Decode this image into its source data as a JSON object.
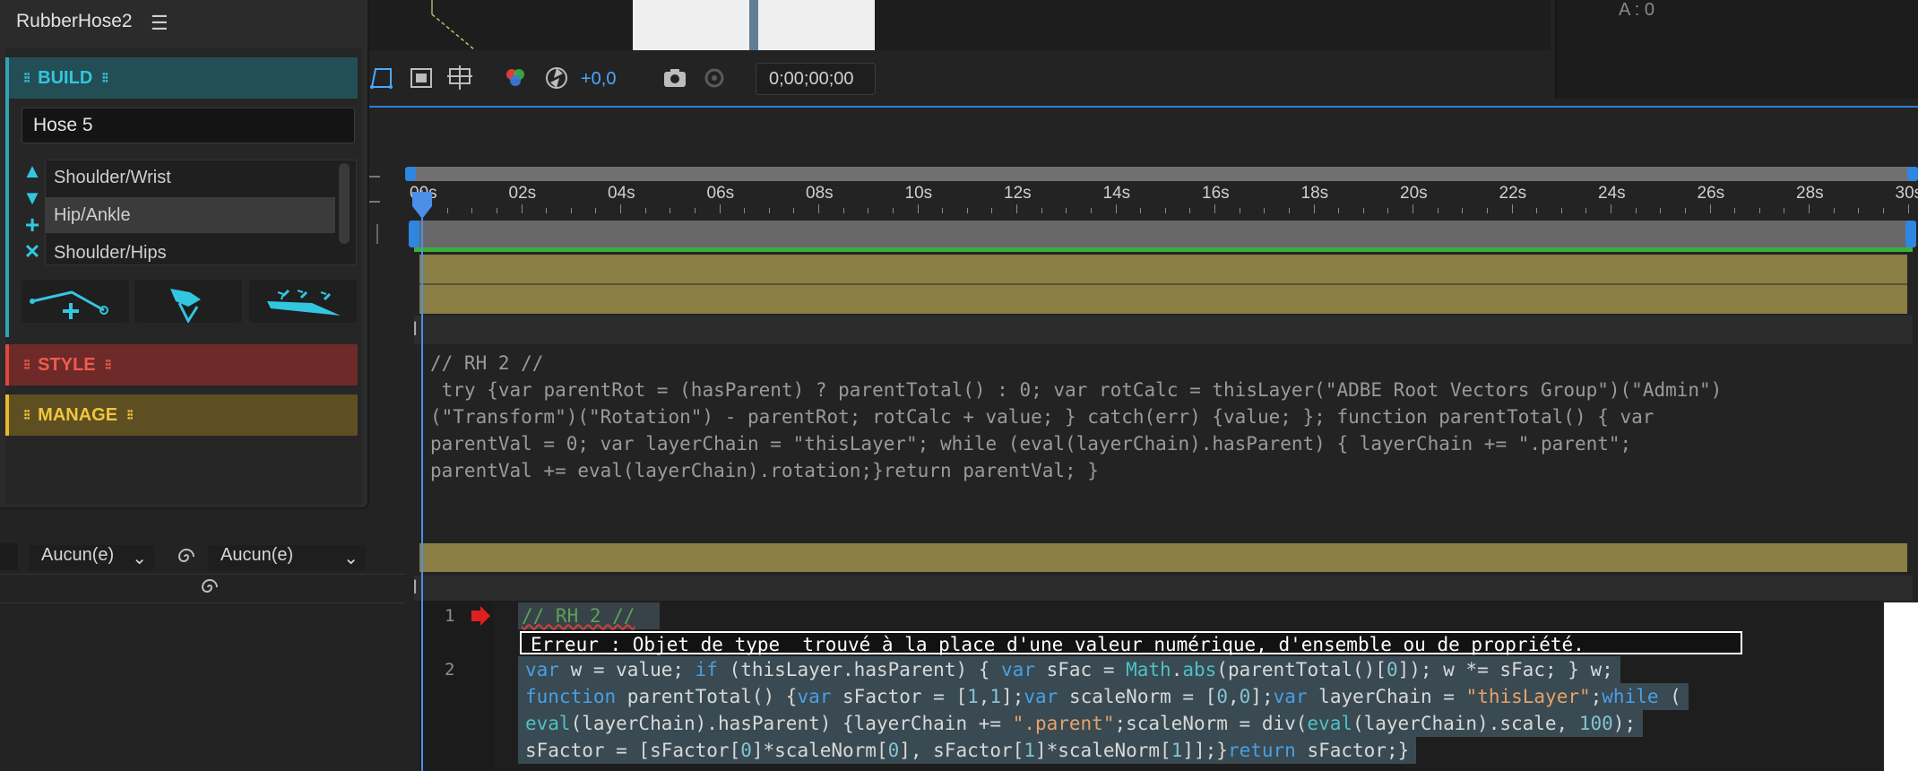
{
  "panel": {
    "title": "RubberHose2",
    "menu_icon": "hamburger-icon",
    "sections": {
      "build": "BUILD",
      "style": "STYLE",
      "manage": "MANAGE"
    },
    "hose_name_value": "Hose 5",
    "list_items": [
      "Shoulder/Wrist",
      "Hip/Ankle",
      "Shoulder/Hips"
    ],
    "selected_item": "Hip/Ankle",
    "colors": {
      "build": "#33c6e0",
      "style": "#f05a4f",
      "manage": "#f0c63d"
    }
  },
  "viewer": {
    "readout": "A : 0",
    "offset_value": "+0,0",
    "timecode": "0;00;00;00"
  },
  "layer_controls": {
    "dropdown_1": "Aucun(e)",
    "dropdown_2": "Aucun(e)"
  },
  "timeline": {
    "ruler_labels": [
      "00s",
      "02s",
      "04s",
      "06s",
      "08s",
      "10s",
      "12s",
      "14s",
      "16s",
      "18s",
      "20s",
      "22s",
      "24s",
      "26s",
      "28s",
      "30s"
    ],
    "expression_text": "// RH 2 //\n try {var parentRot = (hasParent) ? parentTotal() : 0; var rotCalc = thisLayer(\"ADBE Root Vectors Group\")(\"Admin\")\n(\"Transform\")(\"Rotation\") - parentRot; rotCalc + value; } catch(err) {value; }; function parentTotal() { var\nparentVal = 0; var layerChain = \"thisLayer\"; while (eval(layerChain).hasParent) { layerChain += \".parent\";\nparentVal += eval(layerChain).rotation;}return parentVal; }"
  },
  "editor": {
    "line_numbers": [
      "1",
      "2"
    ],
    "line1": "// RH 2 //",
    "error_message": "Erreur : Objet de type  trouvé à la place d'une valeur numérique, d'ensemble ou de propriété."
  }
}
